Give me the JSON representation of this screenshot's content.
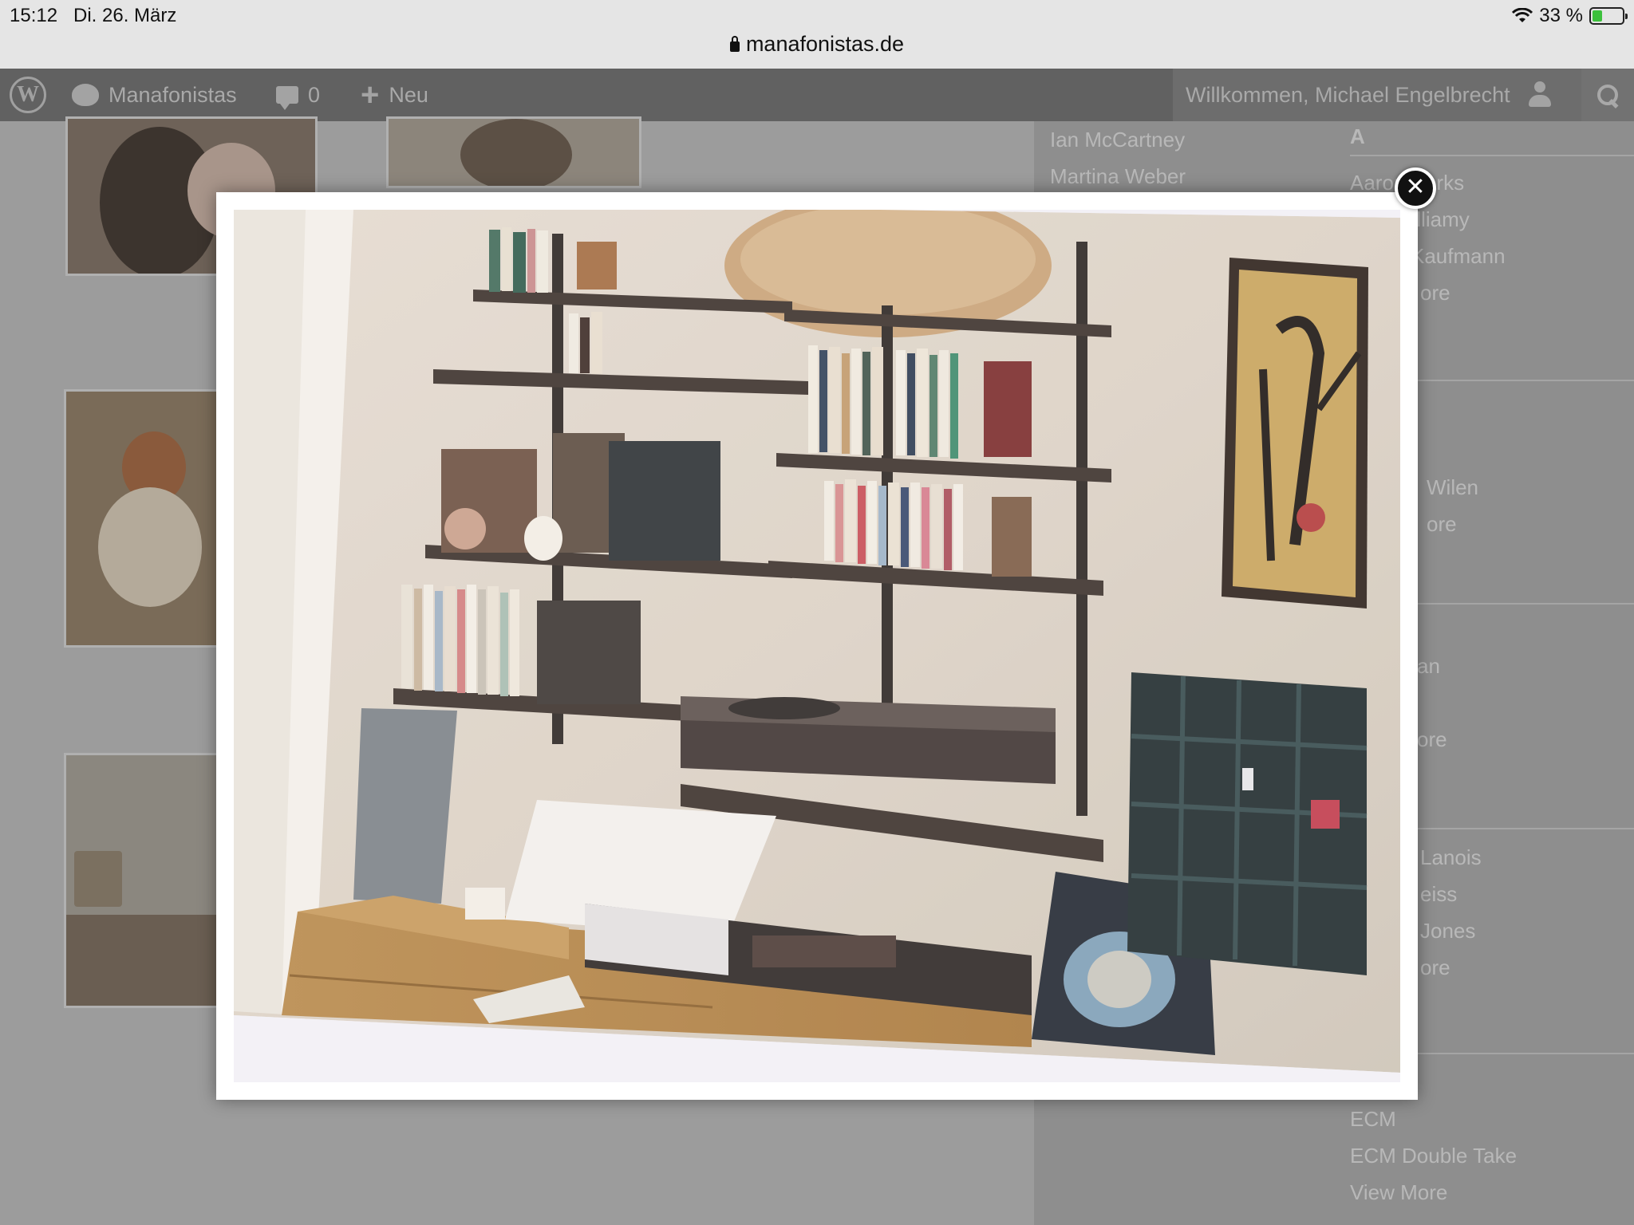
{
  "status_bar": {
    "time": "15:12",
    "date": "Di. 26. März",
    "battery": "33 %",
    "battery_level": 0.33,
    "url": "manafonistas.de"
  },
  "admin_bar": {
    "site_name": "Manafonistas",
    "comment_count": "0",
    "new_label": "Neu",
    "welcome": "Willkommen, Michael Engelbrecht"
  },
  "sidebar": {
    "names_top": [
      "Ian McCartney",
      "Martina Weber"
    ],
    "index_letter": "A",
    "section1": [
      "Aaron Parks",
      "Alliamy",
      "Kaufmann",
      "ore"
    ],
    "section2": [
      "Wilen",
      "ore"
    ],
    "section3": [
      "an",
      "ore"
    ],
    "section4": [
      "Lanois",
      "eiss",
      "Jones",
      "ore"
    ],
    "section5": [
      "ECM",
      "ECM Double Take",
      "View More"
    ]
  },
  "lightbox": {
    "close_label": "✕"
  },
  "colors": {
    "admin_bar": "#616161",
    "overlay_dim": "#9e9e9e",
    "battery_fill": "#3cc13c"
  }
}
